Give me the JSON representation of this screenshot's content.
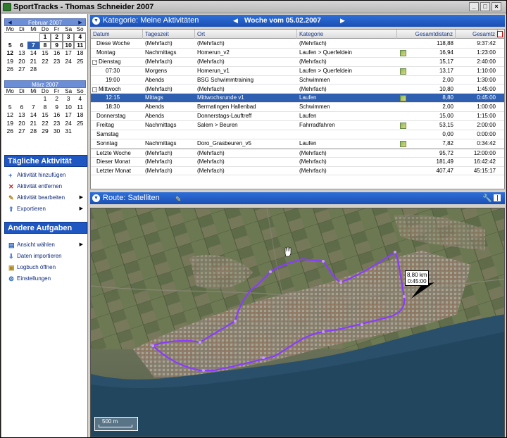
{
  "window": {
    "title": "SportTracks - Thomas Schneider 2007"
  },
  "calendars": [
    {
      "month_label": "Februar 2007",
      "dow": [
        "Mo",
        "Di",
        "Mi",
        "Do",
        "Fr",
        "Sa",
        "So"
      ],
      "weeks": [
        [
          "",
          "",
          "",
          "1",
          "2",
          "3",
          "4"
        ],
        [
          "5",
          "6",
          "7",
          "8",
          "9",
          "10",
          "11"
        ],
        [
          "12",
          "13",
          "14",
          "15",
          "16",
          "17",
          "18"
        ],
        [
          "19",
          "20",
          "21",
          "22",
          "23",
          "24",
          "25"
        ],
        [
          "26",
          "27",
          "28",
          "",
          "",
          "",
          ""
        ]
      ]
    },
    {
      "month_label": "März 2007",
      "dow": [
        "Mo",
        "Di",
        "Mi",
        "Do",
        "Fr",
        "Sa",
        "So"
      ],
      "weeks": [
        [
          "",
          "",
          "",
          "1",
          "2",
          "3",
          "4"
        ],
        [
          "5",
          "6",
          "7",
          "8",
          "9",
          "10",
          "11"
        ],
        [
          "12",
          "13",
          "14",
          "15",
          "16",
          "17",
          "18"
        ],
        [
          "19",
          "20",
          "21",
          "22",
          "23",
          "24",
          "25"
        ],
        [
          "26",
          "27",
          "28",
          "29",
          "30",
          "31",
          ""
        ]
      ]
    }
  ],
  "daily_tasks": {
    "title": "Tägliche Aktivität",
    "items": [
      {
        "label": "Aktivität hinzufügen",
        "icon": "add-icon",
        "submenu": false
      },
      {
        "label": "Aktivität entfernen",
        "icon": "delete-icon",
        "submenu": false
      },
      {
        "label": "Aktivität bearbeiten",
        "icon": "edit-icon",
        "submenu": true
      },
      {
        "label": "Exportieren",
        "icon": "export-icon",
        "submenu": true
      }
    ]
  },
  "other_tasks": {
    "title": "Andere Aufgaben",
    "items": [
      {
        "label": "Ansicht wählen",
        "icon": "view-icon",
        "submenu": true
      },
      {
        "label": "Daten importieren",
        "icon": "import-icon",
        "submenu": false
      },
      {
        "label": "Logbuch öffnen",
        "icon": "logbook-icon",
        "submenu": false
      },
      {
        "label": "Einstellungen",
        "icon": "settings-icon",
        "submenu": false
      }
    ]
  },
  "activities_panel": {
    "title": "Kategorie: Meine Aktivitäten",
    "week_label": "Woche vom 05.02.2007",
    "columns": [
      "Datum",
      "Tageszeit",
      "Ort",
      "Kategorie",
      "Gesamtdistanz",
      "Gesamtz"
    ],
    "rows": [
      {
        "datum": "Diese Woche",
        "tageszeit": "(Mehrfach)",
        "ort": "(Mehrfach)",
        "kategorie": "(Mehrfach)",
        "distanz": "118,88",
        "zeit": "9:37:42"
      },
      {
        "datum": "Montag",
        "tageszeit": "Nachmittags",
        "ort": "Homerun_v2",
        "kategorie": "Laufen > Querfeldein",
        "distanz": "16,94",
        "zeit": "1:23:00"
      },
      {
        "datum": "Dienstag",
        "tageszeit": "(Mehrfach)",
        "ort": "(Mehrfach)",
        "kategorie": "(Mehrfach)",
        "distanz": "15,17",
        "zeit": "2:40:00"
      },
      {
        "datum": "07:30",
        "tageszeit": "Morgens",
        "ort": "Homerun_v1",
        "kategorie": "Laufen > Querfeldein",
        "distanz": "13,17",
        "zeit": "1:10:00"
      },
      {
        "datum": "19:00",
        "tageszeit": "Abends",
        "ort": "BSG Schwimmtraining",
        "kategorie": "Schwimmen",
        "distanz": "2,00",
        "zeit": "1:30:00"
      },
      {
        "datum": "Mittwoch",
        "tageszeit": "(Mehrfach)",
        "ort": "(Mehrfach)",
        "kategorie": "(Mehrfach)",
        "distanz": "10,80",
        "zeit": "1:45:00"
      },
      {
        "datum": "12:15",
        "tageszeit": "Mittags",
        "ort": "Mittwochsrunde v1",
        "kategorie": "Laufen",
        "distanz": "8,80",
        "zeit": "0:45:00"
      },
      {
        "datum": "18:30",
        "tageszeit": "Abends",
        "ort": "Bermatingen Hallenbad",
        "kategorie": "Schwimmen",
        "distanz": "2,00",
        "zeit": "1:00:00"
      },
      {
        "datum": "Donnerstag",
        "tageszeit": "Abends",
        "ort": "Donnerstags-Lauftreff",
        "kategorie": "Laufen",
        "distanz": "15,00",
        "zeit": "1:15:00"
      },
      {
        "datum": "Freitag",
        "tageszeit": "Nachmittags",
        "ort": "Salem > Beuren",
        "kategorie": "Fahrradfahren",
        "distanz": "53,15",
        "zeit": "2:00:00"
      },
      {
        "datum": "Samstag",
        "tageszeit": "",
        "ort": "",
        "kategorie": "",
        "distanz": "0,00",
        "zeit": "0:00:00"
      },
      {
        "datum": "Sonntag",
        "tageszeit": "Nachmittags",
        "ort": "Doro_Grasbeuren_v5",
        "kategorie": "Laufen",
        "distanz": "7,82",
        "zeit": "0:34:42"
      },
      {
        "datum": "Letzte Woche",
        "tageszeit": "(Mehrfach)",
        "ort": "(Mehrfach)",
        "kategorie": "(Mehrfach)",
        "distanz": "95,72",
        "zeit": "12:00:00"
      },
      {
        "datum": "Dieser Monat",
        "tageszeit": "(Mehrfach)",
        "ort": "(Mehrfach)",
        "kategorie": "(Mehrfach)",
        "distanz": "181,49",
        "zeit": "16:42:42"
      },
      {
        "datum": "Letzter Monat",
        "tageszeit": "(Mehrfach)",
        "ort": "(Mehrfach)",
        "kategorie": "(Mehrfach)",
        "distanz": "407,47",
        "zeit": "45:15:17"
      }
    ]
  },
  "route_panel": {
    "title": "Route: Satelliten",
    "marker_distance": "8,80 km",
    "marker_time": "0:45:00",
    "scale_label": "500 m"
  },
  "colors": {
    "panel_header": "#1a4fb5",
    "selection": "#2e5fb0",
    "route": "#8a3cff"
  }
}
